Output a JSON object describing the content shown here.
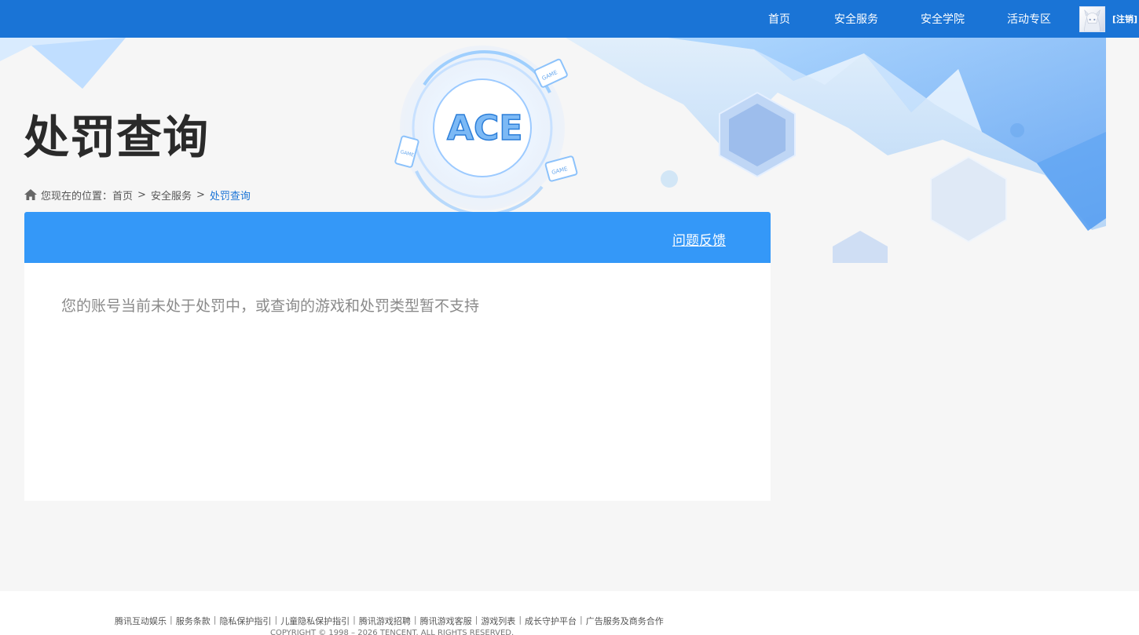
{
  "nav": {
    "items": [
      "首页",
      "安全服务",
      "安全学院",
      "活动专区"
    ],
    "logout": "[注销]"
  },
  "banner": {
    "title": "处罚查询",
    "logo_text": "ACE",
    "game_tag": "GAME"
  },
  "breadcrumb": {
    "prefix": "您现在的位置：",
    "items": [
      "首页",
      "安全服务",
      "处罚查询"
    ],
    "separator": ">"
  },
  "panel": {
    "feedback": "问题反馈",
    "message": "您的账号当前未处于处罚中，或查询的游戏和处罚类型暂不支持"
  },
  "footer": {
    "links": [
      "腾讯互动娱乐",
      "服务条款",
      "隐私保护指引",
      "儿童隐私保护指引",
      "腾讯游戏招聘",
      "腾讯游戏客服",
      "游戏列表",
      "成长守护平台",
      "广告服务及商务合作"
    ],
    "separator": "|",
    "copyright": "COPYRIGHT © 1998 – 2026 TENCENT. ALL RIGHTS RESERVED."
  },
  "colors": {
    "topbar": "#1a74d6",
    "panel_header": "#3498f8",
    "link_current": "#1a74d6"
  }
}
